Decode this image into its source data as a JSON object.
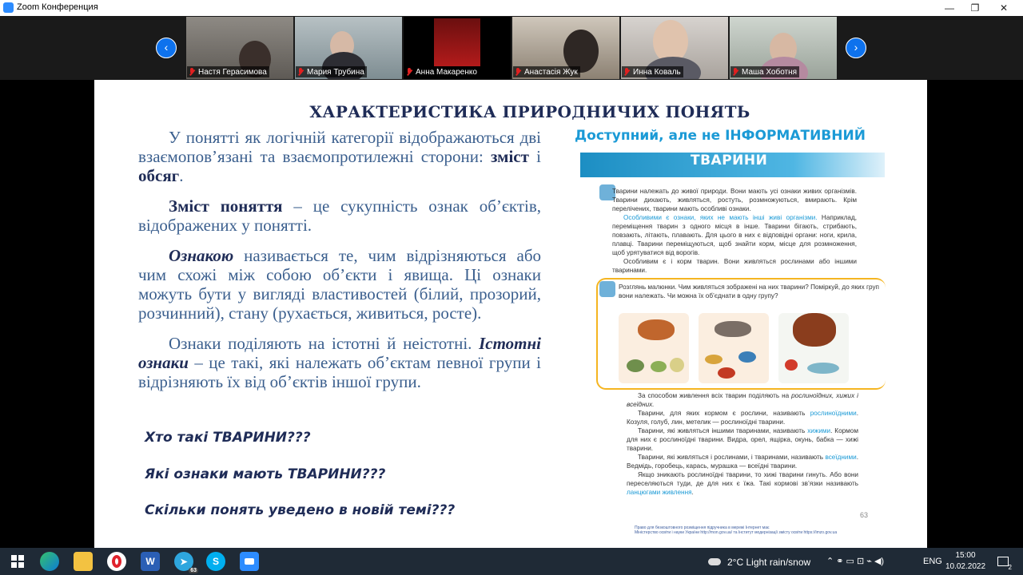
{
  "window": {
    "title": "Zoom Конференция",
    "minimize": "—",
    "maximize": "❐",
    "close": "✕"
  },
  "gallery": {
    "prev": "‹",
    "next": "›",
    "participants": [
      {
        "name": "Настя Герасимова"
      },
      {
        "name": "Мария Трубина"
      },
      {
        "name": "Анна Макаренко"
      },
      {
        "name": "Анастасія Жук"
      },
      {
        "name": "Инна Коваль"
      },
      {
        "name": "Маша Хоботня"
      }
    ]
  },
  "slide": {
    "title": "ХАРАКТЕРИСТИКА ПРИРОДНИЧИХ ПОНЯТЬ",
    "p1_text": "У понятті як логічній категорії відображаються дві взаємопов’язані та взаємопротилежні сторони: ",
    "p1_b1": "зміст",
    "p1_and": " і ",
    "p1_b2": "обсяг",
    "p1_end": ".",
    "p2_term": "Зміст поняття",
    "p2_text": " – це сукупність ознак об’єктів, відображених у понятті.",
    "p3_term": "Ознакою",
    "p3_text": " називається те, чим відрізняються або чим схожі між собою об’єкти і явища. Ці ознаки можуть бути у вигляді властивостей (білий, прозорий, розчинний), стану (рухається, живиться, росте).",
    "p4_text": "Ознаки поділяють на істотні й неістотні. ",
    "p4_term": "Істотні ознаки",
    "p4_rest": " – це такі, які належать об’єктам певної групи і відрізняють їх від об’єктів іншої групи.",
    "q1": "Хто такі ТВАРИНИ???",
    "q2": "Які ознаки мають ТВАРИНИ???",
    "q3": "Скільки понять уведено в новій темі???",
    "subheading": "Доступний, але не ІНФОРМАТИВНИЙ",
    "book": {
      "banner": "ТВАРИНИ",
      "intro": "Тварини належать до живої природи. Вони мають усі ознаки живих організмів. Тварини дихають, живляться, ростуть, розмножуються, вмирають. Крім перелічених, тварини мають особливі ознаки.",
      "special_blue": "Особливими є ознаки, яких не мають інші живі організми.",
      "special_rest": " Наприклад, переміщення тварин з одного місця в інше. Тварини бігають, стрибають, повзають, літають, плавають. Для цього в них є відповідні органи: ноги, крила, плавці. Тварини переміщуються, щоб знайти корм, місце для розмноження, щоб урятуватися від ворогів.",
      "food": "Особливим є і корм тварин. Вони живляться рослинами або іншими тваринами.",
      "question": "Розглянь малюнки. Чим живляться зображені на них тварини? Поміркуй, до яких груп вони належать. Чи можна їх об’єднати в одну групу?",
      "g1_a": "За способом живлення всіх тварин поділяють на ",
      "g1_i": "рослиноїдних, хижих і всеїдних.",
      "g2_a": "Тварини, для яких кормом є рослини, називають ",
      "g2_b": "рослиноїдними",
      "g2_c": ". Козуля, голуб, лин, метелик — рослиноїдні тварини.",
      "g3_a": "Тварини, які живляться іншими тваринами, називають ",
      "g3_b": "хижими",
      "g3_c": ". Кормом для них є рослиноїдні тварини. Видра, орел, ящірка, окунь, бабка — хижі тварини.",
      "g4_a": "Тварини, які живляться і рослинами, і тваринами, називають ",
      "g4_b": "всеїдними",
      "g4_c": ". Ведмідь, горобець, карась, мурашка — всеїдні тварини.",
      "g5": "Якщо зникають рослиноїдні тварини, то хижі тварини гинуть. Або вони переселяються туди, де для них є їжа. Такі кормові зв’язки називають ",
      "g5_b": "ланцюгами живлення",
      "g5_c": ".",
      "page": "63",
      "footnote1": "Право для безкоштовного розміщення підручника в мережі Інтернет має",
      "footnote2": "Міністерство освіти і науки України http://mon.gov.ua/ та Інститут модернізації змісту освіти https://imzo.gov.ua"
    }
  },
  "taskbar": {
    "weather": "2°C  Light rain/snow",
    "lang": "ENG",
    "time": "15:00",
    "date": "10.02.2022",
    "notifications": "2",
    "icons": [
      "windows-icon",
      "edge-icon",
      "file-explorer-icon",
      "opera-icon",
      "word-icon",
      "telegram-icon",
      "skype-icon",
      "zoom-icon"
    ],
    "telegram_badge": "63",
    "word_letter": "W",
    "skype_letter": "S"
  }
}
